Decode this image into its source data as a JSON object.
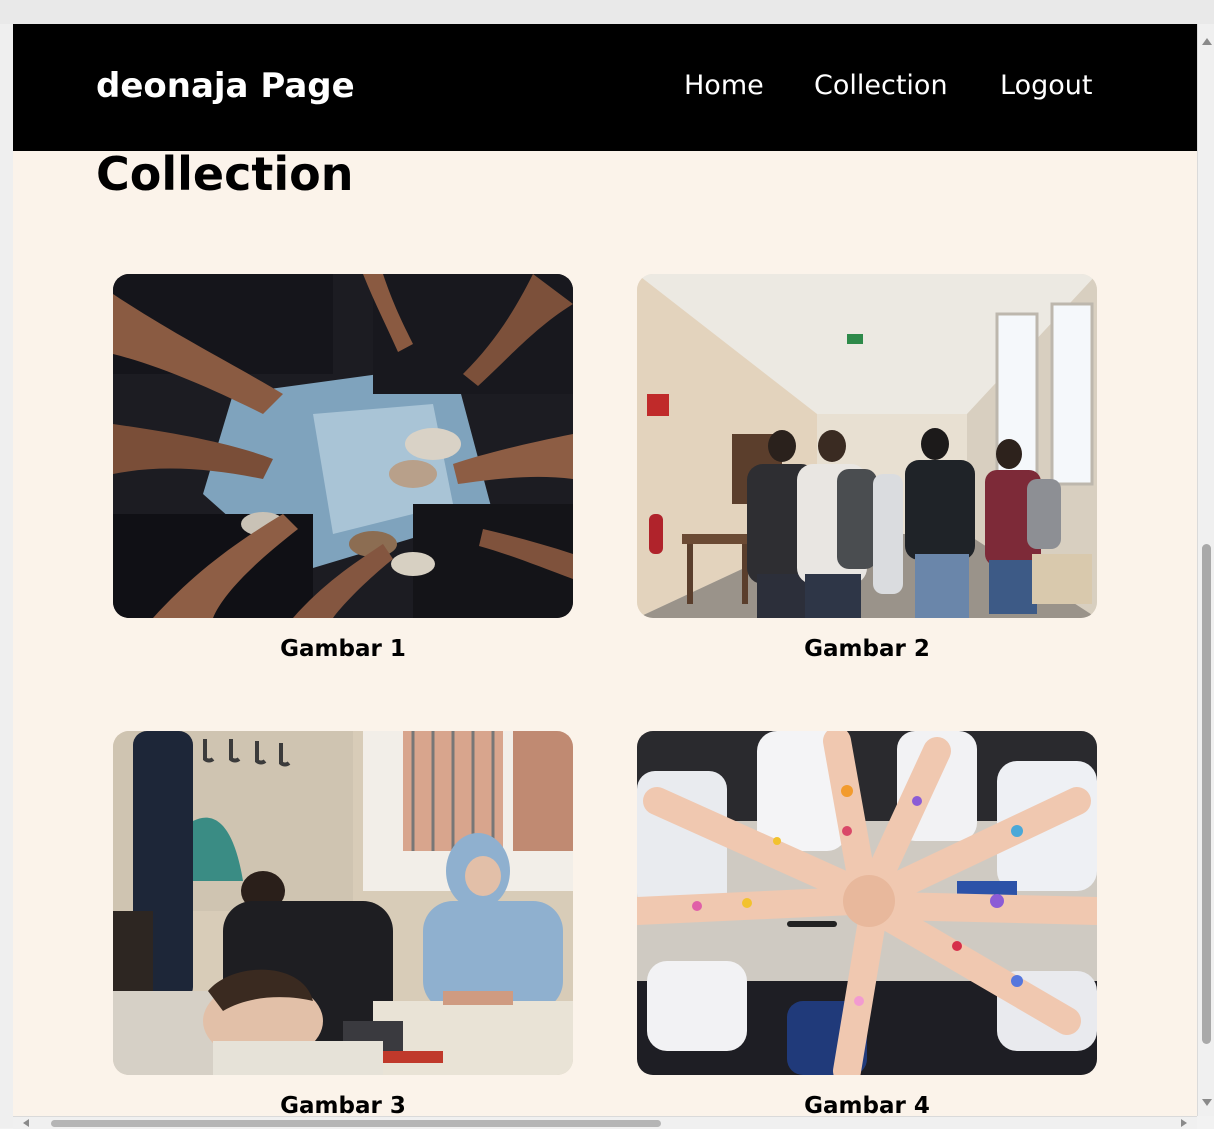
{
  "navbar": {
    "brand": "deonaja Page",
    "links": [
      {
        "label": "Home"
      },
      {
        "label": "Collection"
      },
      {
        "label": "Logout"
      }
    ]
  },
  "main": {
    "heading": "Collection",
    "gallery": [
      {
        "caption": "Gambar 1",
        "image": "photo-hands-peace-signs"
      },
      {
        "caption": "Gambar 2",
        "image": "photo-school-hallway-students"
      },
      {
        "caption": "Gambar 3",
        "image": "photo-classroom-students"
      },
      {
        "caption": "Gambar 4",
        "image": "photo-painted-arms-circle"
      }
    ]
  },
  "colors": {
    "navbar_bg": "#000000",
    "page_bg": "#fbf3ea",
    "text": "#000000",
    "nav_text": "#ffffff"
  }
}
